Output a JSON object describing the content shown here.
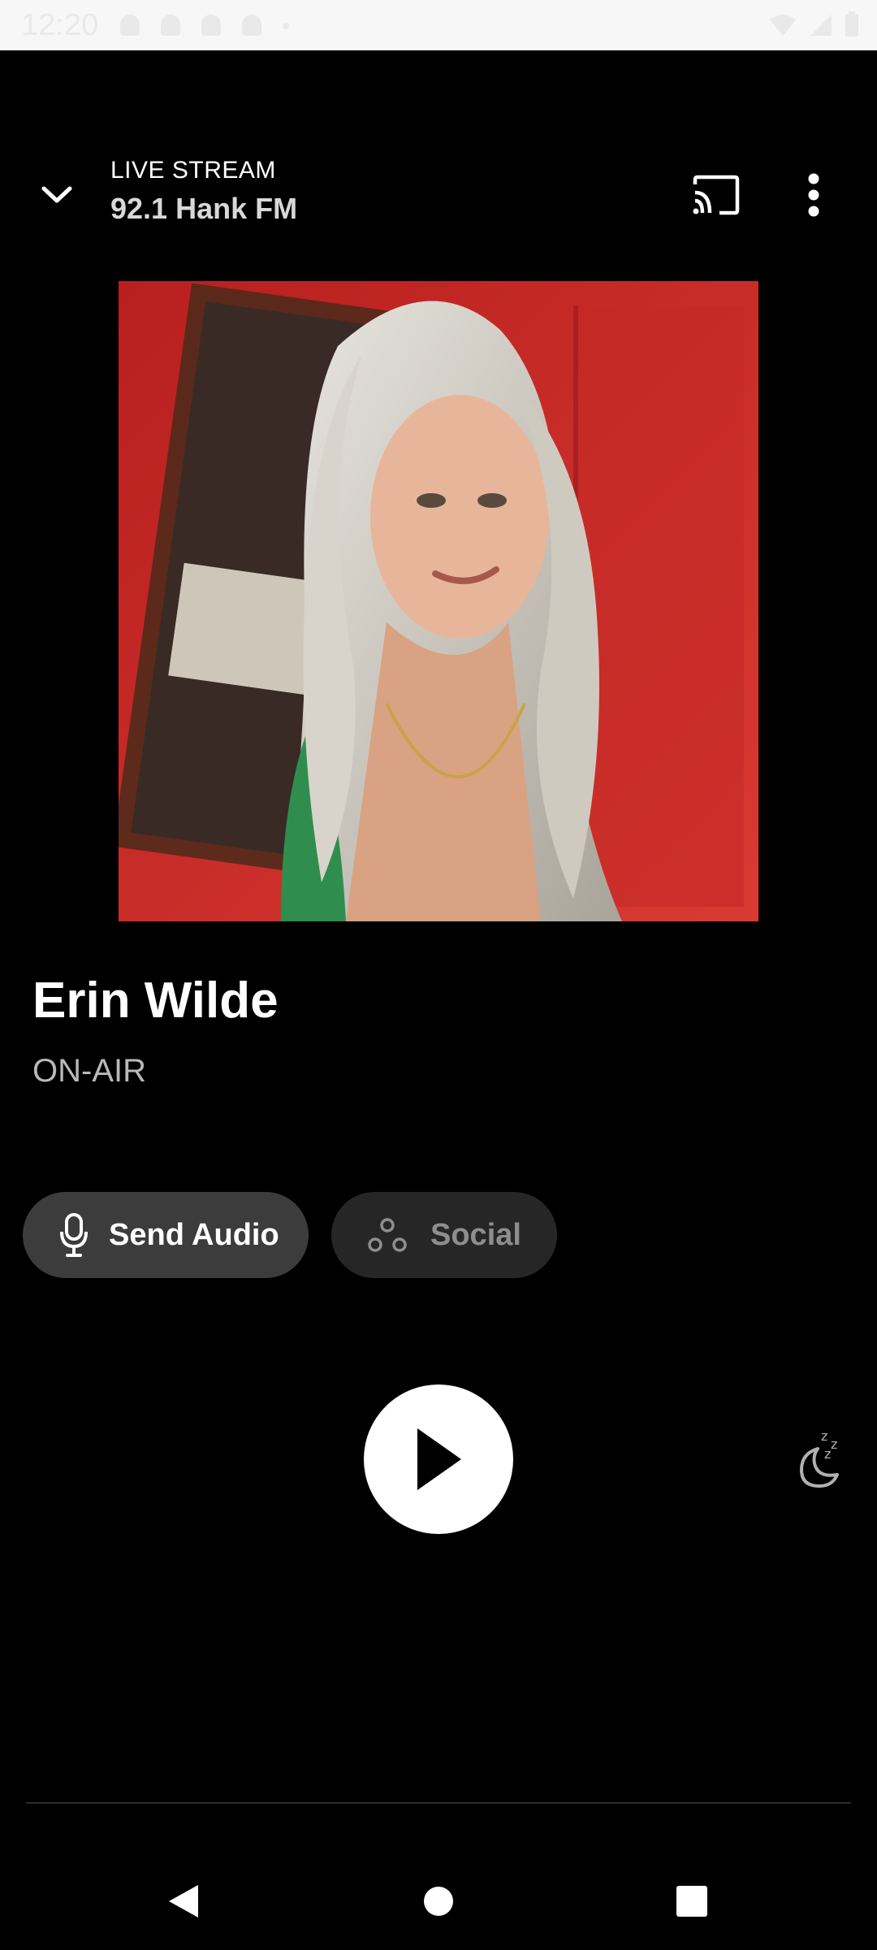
{
  "status_bar": {
    "time": "12:20"
  },
  "header": {
    "label": "LIVE STREAM",
    "station": "92.1 Hank FM",
    "collapse_icon": "chevron-down-icon",
    "cast_icon": "cast-icon",
    "more_icon": "more-vertical-icon"
  },
  "now_playing": {
    "host_name": "Erin Wilde",
    "status": "ON-AIR"
  },
  "actions": {
    "send_audio_label": "Send Audio",
    "social_label": "Social"
  },
  "controls": {
    "play_icon": "play-icon",
    "sleep_icon": "sleep-timer-icon"
  },
  "colors": {
    "background": "#000000",
    "accent_white": "#ffffff",
    "button_dark": "#3c3c3c",
    "button_darker": "#262626",
    "artwork_red": "#c82626"
  }
}
